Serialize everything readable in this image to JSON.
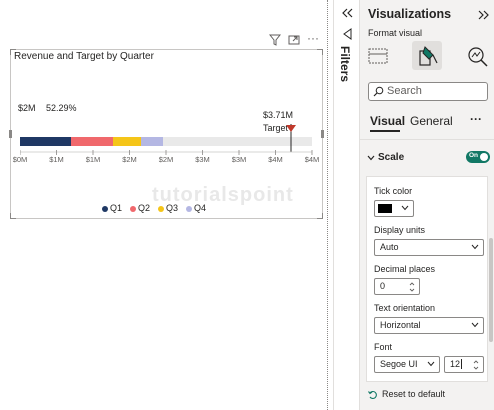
{
  "visual": {
    "title": "Revenue and Target by Quarter",
    "value_label": "$2M",
    "percent_label": "52.29%",
    "target_value": "$3.71M",
    "target_label": "Target",
    "axis_ticks": [
      "$0M",
      "$1M",
      "$1M",
      "$2M",
      "$2M",
      "$3M",
      "$3M",
      "$4M",
      "$4M"
    ],
    "legend": [
      {
        "label": "Q1",
        "color": "#1f3864"
      },
      {
        "label": "Q2",
        "color": "#f0686c"
      },
      {
        "label": "Q3",
        "color": "#f5c518"
      },
      {
        "label": "Q4",
        "color": "#b4b7e3"
      }
    ],
    "watermark": "tutorialspoint",
    "header_icons": [
      "filter-icon",
      "focus-mode-icon",
      "more-options-icon"
    ]
  },
  "filters": {
    "label": "Filters",
    "collapse_icon": "double-chevron-left-icon",
    "toggle_icon": "filter-pane-icon"
  },
  "pane": {
    "title": "Visualizations",
    "expand_icon": "double-chevron-right-icon",
    "subtitle": "Format visual",
    "search_placeholder": "Search",
    "tabs": {
      "visual": "Visual",
      "general": "General",
      "more": "···"
    },
    "section": {
      "label": "Scale",
      "toggle": "On"
    },
    "fields": {
      "tick_color_label": "Tick color",
      "tick_color_value": "#000000",
      "display_units_label": "Display units",
      "display_units_value": "Auto",
      "decimal_places_label": "Decimal places",
      "decimal_places_value": "0",
      "text_orientation_label": "Text orientation",
      "text_orientation_value": "Horizontal",
      "font_label": "Font",
      "font_family_value": "Segoe UI",
      "font_size_value": "12"
    },
    "reset_label": "Reset to default"
  },
  "colors": {
    "toggle_on": "#117865",
    "target_marker": "#c0392b"
  }
}
